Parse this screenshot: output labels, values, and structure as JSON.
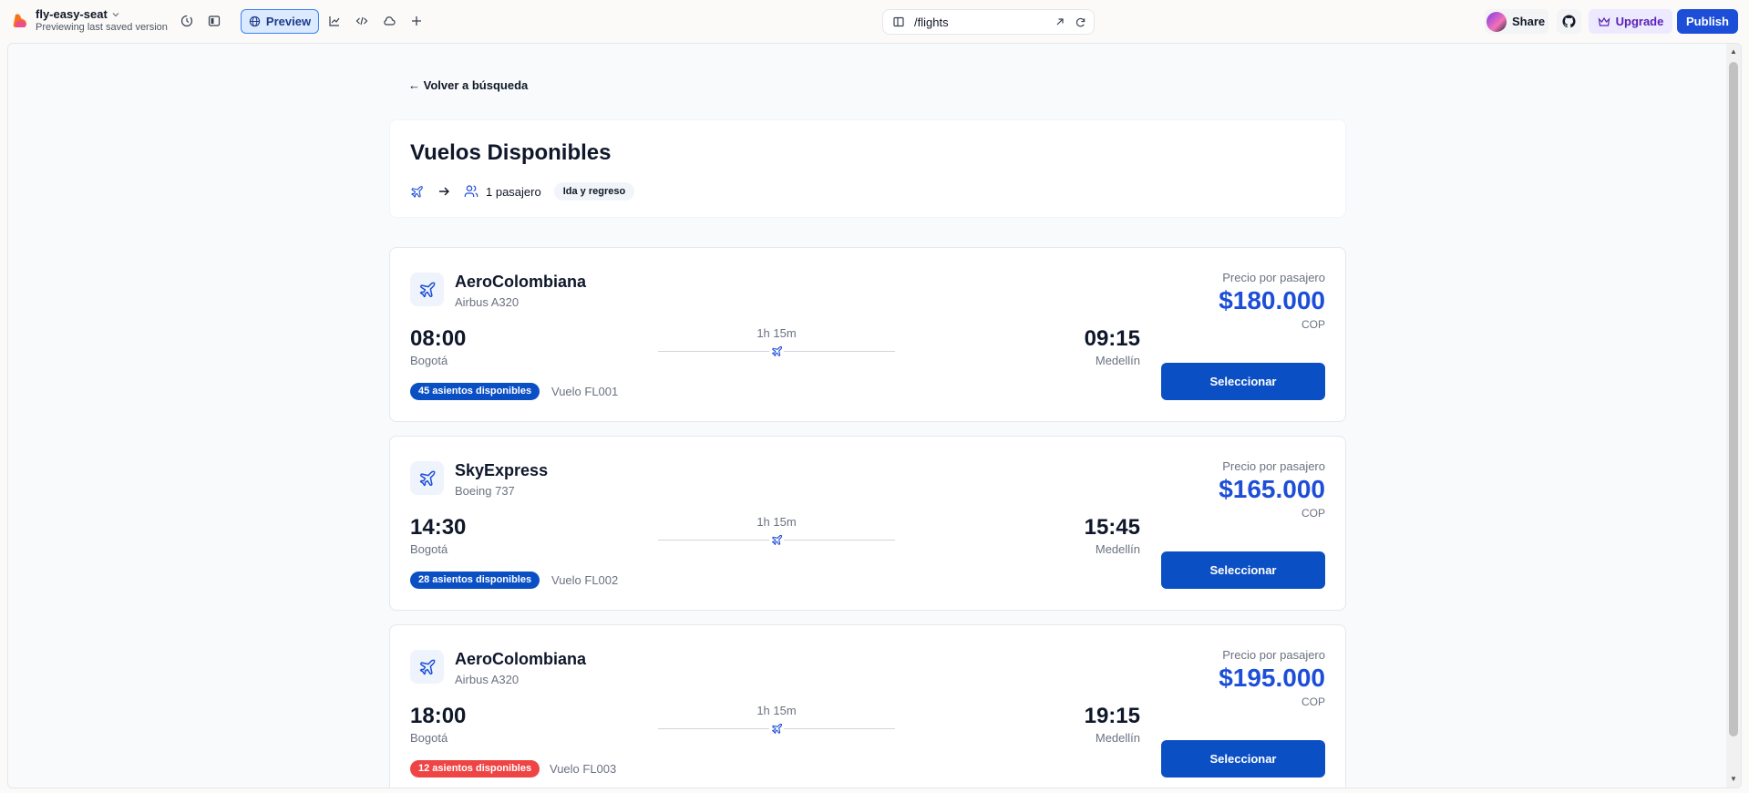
{
  "topbar": {
    "project_name": "fly-easy-seat",
    "project_sub": "Previewing last saved version",
    "preview_label": "Preview",
    "url_path": "/flights",
    "share_label": "Share",
    "upgrade_label": "Upgrade",
    "publish_label": "Publish"
  },
  "page": {
    "back_link": "← Volver a búsqueda",
    "title": "Vuelos Disponibles",
    "passengers": "1 pasajero",
    "trip_type": "Ida y regreso"
  },
  "flights": [
    {
      "airline": "AeroColombiana",
      "aircraft": "Airbus A320",
      "dep_time": "08:00",
      "dep_city": "Bogotá",
      "arr_time": "09:15",
      "arr_city": "Medellín",
      "duration": "1h 15m",
      "seats": "45 asientos disponibles",
      "seats_color": "#0b4fc4",
      "flight_no": "Vuelo FL001",
      "price_label": "Precio por pasajero",
      "price": "$180.000",
      "currency": "COP",
      "select_label": "Seleccionar"
    },
    {
      "airline": "SkyExpress",
      "aircraft": "Boeing 737",
      "dep_time": "14:30",
      "dep_city": "Bogotá",
      "arr_time": "15:45",
      "arr_city": "Medellín",
      "duration": "1h 15m",
      "seats": "28 asientos disponibles",
      "seats_color": "#0b4fc4",
      "flight_no": "Vuelo FL002",
      "price_label": "Precio por pasajero",
      "price": "$165.000",
      "currency": "COP",
      "select_label": "Seleccionar"
    },
    {
      "airline": "AeroColombiana",
      "aircraft": "Airbus A320",
      "dep_time": "18:00",
      "dep_city": "Bogotá",
      "arr_time": "19:15",
      "arr_city": "Medellín",
      "duration": "1h 15m",
      "seats": "12 asientos disponibles",
      "seats_color": "#ef4444",
      "flight_no": "Vuelo FL003",
      "price_label": "Precio por pasajero",
      "price": "$195.000",
      "currency": "COP",
      "select_label": "Seleccionar"
    }
  ],
  "colors": {
    "accent": "#1d4ed8",
    "button": "#0b4fc4",
    "warning": "#ef4444"
  }
}
